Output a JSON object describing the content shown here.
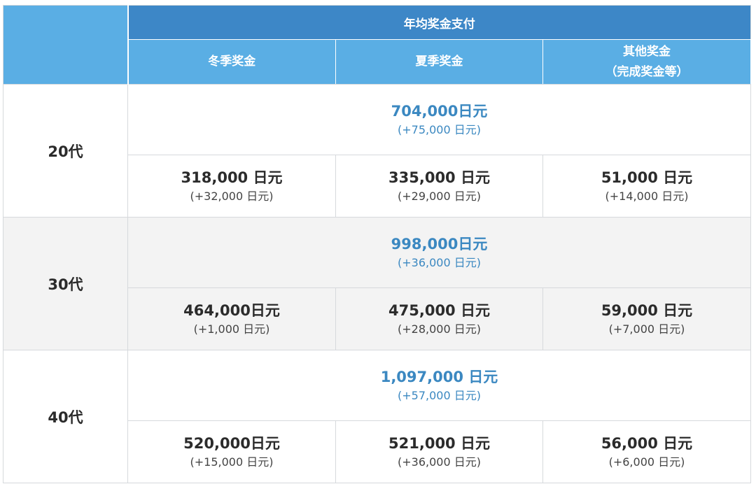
{
  "header": {
    "top_label": "年均奖金支付",
    "columns": [
      {
        "line1": "冬季奖金",
        "line2": ""
      },
      {
        "line1": "夏季奖金",
        "line2": ""
      },
      {
        "line1": "其他奖金",
        "line2": "（完成奖金等）"
      }
    ]
  },
  "rows": [
    {
      "age": "20代",
      "total": {
        "main": "704,000日元",
        "sub": "(+75,000 日元)"
      },
      "cells": [
        {
          "main": "318,000 日元",
          "sub": "(+32,000 日元)"
        },
        {
          "main": "335,000 日元",
          "sub": "(+29,000 日元)"
        },
        {
          "main": "51,000 日元",
          "sub": "(+14,000 日元)"
        }
      ]
    },
    {
      "age": "30代",
      "total": {
        "main": "998,000日元",
        "sub": "(+36,000 日元)"
      },
      "cells": [
        {
          "main": "464,000日元",
          "sub": "(+1,000 日元)"
        },
        {
          "main": "475,000 日元",
          "sub": "(+28,000 日元)"
        },
        {
          "main": "59,000 日元",
          "sub": "(+7,000 日元)"
        }
      ]
    },
    {
      "age": "40代",
      "total": {
        "main": "1,097,000 日元",
        "sub": "(+57,000 日元)"
      },
      "cells": [
        {
          "main": "520,000日元",
          "sub": "(+15,000 日元)"
        },
        {
          "main": "521,000 日元",
          "sub": "(+36,000 日元)"
        },
        {
          "main": "56,000 日元",
          "sub": "(+6,000 日元)"
        }
      ]
    }
  ],
  "colors": {
    "header_dark": "#3d87c7",
    "header_light": "#5aaee4",
    "total_text": "#3b88c1",
    "shaded_row": "#f3f3f3"
  }
}
